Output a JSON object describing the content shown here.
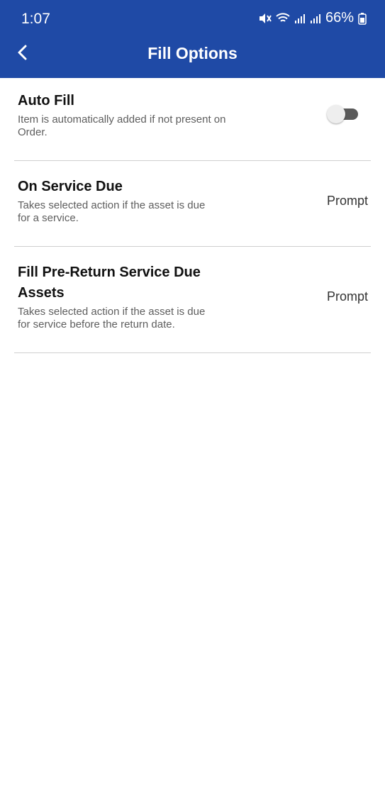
{
  "status_bar": {
    "time": "1:07",
    "battery": "66%"
  },
  "app_bar": {
    "title": "Fill Options",
    "back_icon": "chevron-left-icon"
  },
  "colors": {
    "app_bar": "#1f4aa6",
    "divider": "#cfcfcf",
    "title_text": "#111111",
    "desc_text": "#5e5e5e"
  },
  "options": [
    {
      "title": "Auto Fill",
      "description_line1": "Item is automatically added if not present on",
      "description_line2": "Order.",
      "control": "toggle",
      "enabled": false
    },
    {
      "title": "On Service Due",
      "description_line1": "Takes selected action if the asset is due",
      "description_line2": "for a service.",
      "value": "Prompt"
    },
    {
      "title_line1": "Fill Pre-Return Service Due",
      "title_line2": "Assets",
      "description_line1": "Takes selected action if the asset is due",
      "description_line2": "for service before the return date.",
      "value": "Prompt"
    }
  ]
}
